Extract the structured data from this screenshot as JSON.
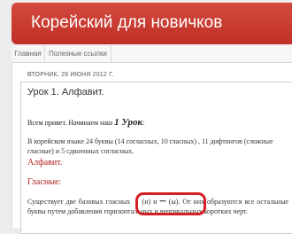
{
  "header": {
    "title": "Корейский для новичков"
  },
  "tabs": [
    {
      "label": "Главная"
    },
    {
      "label": "Полезные ссылки"
    }
  ],
  "post": {
    "date": "ВТОРНИК, 26 ИЮНЯ 2012 Г.",
    "title": "Урок 1. Алфавит.",
    "intro_text": "Всем  привет. Начинаем наш ",
    "lesson_label": "1 Урок",
    "intro_colon": ":",
    "paragraph1": "В корейском языке 24 буквы (14 согласных, 10 гласных) , 11 дифтонгов (сложные гласные) и 5 сдвоенных согласных.",
    "subheading1": "Алфавит.",
    "subheading2": "Гласные:",
    "p2_start": "Существует две базовых гласных ",
    "vowel1": "ㅣ",
    "vowel1_reading": " (и) и ",
    "vowel2": "ㅡ",
    "p2_end": " (ы). От них образуются все остальные буквы путем добавления горизонтальных и вертикальных коротких черт."
  },
  "colors": {
    "header_bg": "#c9362c",
    "highlight": "#d31f26",
    "subheading": "#b22222"
  }
}
